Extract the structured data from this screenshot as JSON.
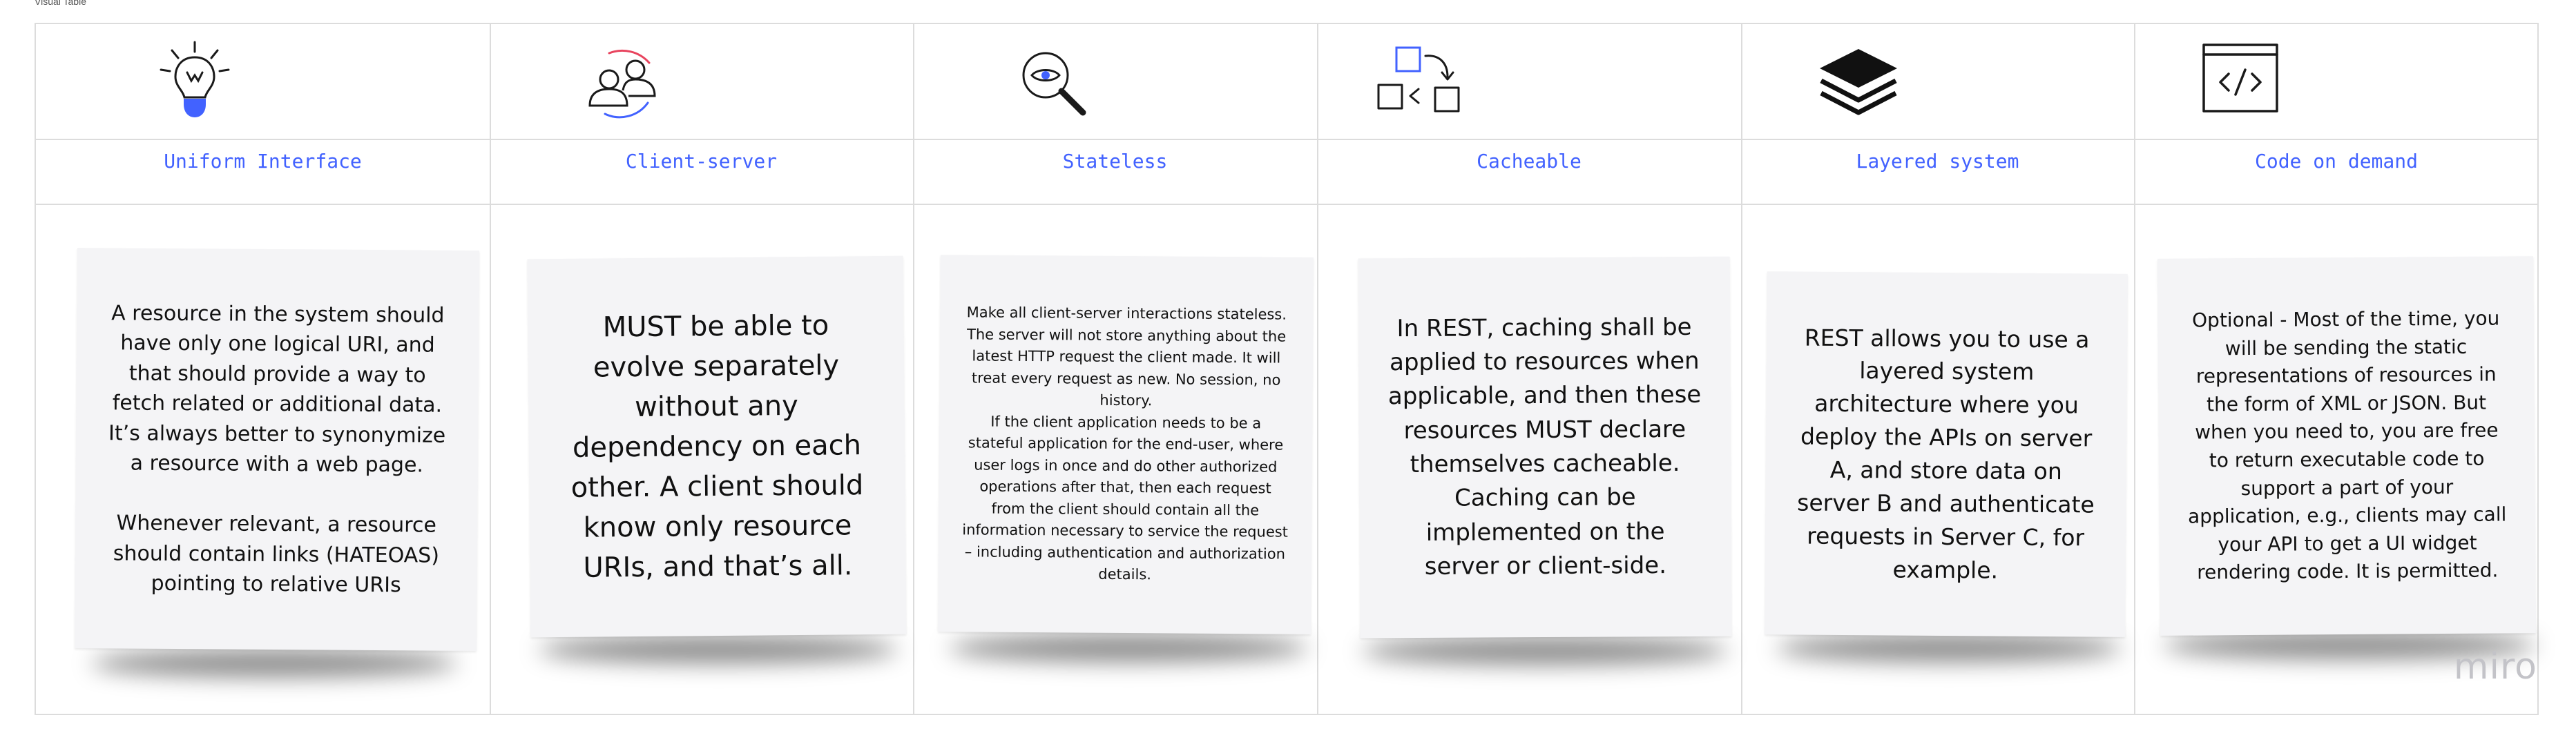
{
  "board": {
    "caption": "Visual Table",
    "watermark": "miro"
  },
  "colors": {
    "accent": "#4262ff",
    "stroke": "#1a1a1a",
    "note_bg": "#f4f4f6",
    "grid": "#dcdcdc"
  },
  "columns": [
    {
      "icon": "lightbulb-icon",
      "title": "Uniform Interface",
      "text": "A resource in the system should have only one logical URI, and that should provide a way to fetch related or additional data. It’s always better to synonymize a resource with a web page.\n\nWhenever relevant, a resource should contain links (HATEOAS) pointing to relative URIs"
    },
    {
      "icon": "users-icon",
      "title": "Client-server",
      "text": "MUST be able to evolve separately without any dependency on each other. A client should know only resource URIs, and that’s all."
    },
    {
      "icon": "magnifier-eye-icon",
      "title": "Stateless",
      "text": "Make all client-server interactions stateless. The server will not store anything about the latest HTTP request the client made. It will treat every request as new. No session, no history.\nIf the client application needs to be a stateful application for the end-user, where user logs in once and do other authorized operations after that, then each request from the client should contain all the information necessary to service the request – including authentication and authorization details."
    },
    {
      "icon": "cache-squares-icon",
      "title": "Cacheable",
      "text": "In REST, caching shall be applied to resources when applicable, and then these resources MUST declare themselves cacheable. Caching can be implemented on the server or client-side."
    },
    {
      "icon": "layers-icon",
      "title": "Layered system",
      "text": "REST allows you to use a layered system architecture where you deploy the APIs on server A, and store data on server B and authenticate requests in Server C, for example."
    },
    {
      "icon": "code-window-icon",
      "title": "Code on demand",
      "text": "Optional - Most of the time, you will be sending the static representations of resources in the form of XML or JSON. But when you need to, you are free to return executable code to support a part of your application, e.g., clients may call your API to get a UI widget rendering code. It is permitted."
    }
  ]
}
